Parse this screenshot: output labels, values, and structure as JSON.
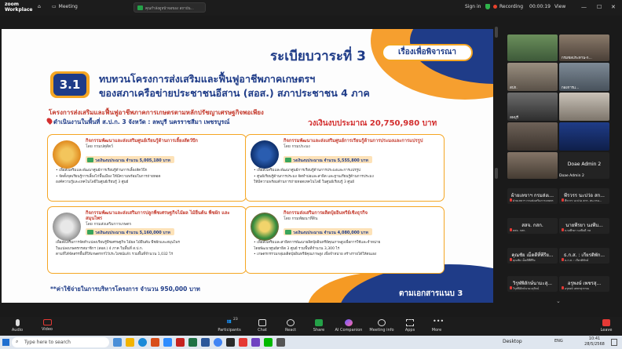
{
  "topbar": {
    "app_name_line1": "zoom",
    "app_name_line2": "Workplace",
    "meeting_label": "Meeting",
    "share_label": "คุณกำลังดูหน้าจอของ สถาบัน...",
    "sign_in": "Sign in",
    "recording_label": "Recording",
    "timer": "00:00:19",
    "view_label": "View"
  },
  "slide": {
    "agenda_title": "ระเบียบวาระที่ 3",
    "agenda_tag": "เรื่องเพื่อพิจารณา",
    "badge": "3.1",
    "heading_line1": "ทบทวนโครงการส่งเสริมและฟื้นฟูอาชีพภาคเกษตรฯ",
    "heading_line2": "ของสภาเครือข่ายประชาชนอีสาน (สอส.) สภาประชาชน 4 ภาค",
    "project_title": "โครงการส่งเสริมและฟื้นฟูอาชีพภาคการเกษตรตามหลักปรัชญาเศรษฐกิจพอเพียง",
    "project_area": "ดำเนินงานในพื้นที่ ส.ป.ก. 3 จังหวัด : ลพบุรี นครราชสีมา เพชรบูรณ์",
    "total_budget": "วงเงินงบประมาณ 20,750,980 บาท",
    "cards": [
      {
        "title": "กิจกรรมพัฒนาและส่งเสริมศูนย์เรียนรู้ด้านการเลี้ยงสัตว์ปีก",
        "org": "โดย กรมปศุสัตว์",
        "budget": "วงเงินงบประมาณ จำนวน 5,005,180 บาท",
        "bullets": [
          "• เพื่อส่งเสริมและพัฒนาศูนย์การเรียนรู้ด้านการเลี้ยงสัตว์ปีก",
          "• จัดตั้งจุดเรียนรู้การเลี้ยงไก่พื้นเมือง ให้มีความพร้อมในการถ่ายทอด",
          "  องค์ความรู้และเทคโนโลยีในศูนย์เรียนรู้ 3 ศูนย์"
        ]
      },
      {
        "title": "กิจกรรมพัฒนาและส่งเสริมศูนย์การเรียนรู้ด้านการประมงและการแปรรูป",
        "org": "โดย กรมประมง",
        "budget": "วงเงินงบประมาณ จำนวน 5,555,800 บาท",
        "bullets": [
          "• เพื่อส่งเสริมและพัฒนาศูนย์การเรียนรู้ด้านการประมงและการแปรรูป",
          "• ศูนย์เรียนรู้ด้านการประมง จัดทำบ่อและสาธิต และฐานเรียนรู้ด้านการประมง",
          "  ให้มีความพร้อมด้านการถ่ายทอดเทคโนโลยี ในศูนย์เรียนรู้ 3 ศูนย์"
        ]
      },
      {
        "title": "กิจกรรมพัฒนาและส่งเสริมการปลูกพืชเศรษฐกิจไม้ผล ไม้ยืนต้น พืชผัก และสมุนไพร",
        "org": "โดย กรมส่งเสริมการเกษตร",
        "budget": "วงเงินงบประมาณ จำนวน 5,160,000 บาท",
        "bullets": [
          "เพื่อส่งเสริมการจัดทำแปลงเรียนรู้พืชเศรษฐกิจ ไม้ผล ไม้ยืนต้น พืชผักและสมุนไพร",
          "ในแปลงเกษตรกรสมาชิกฯ (สอส.) 4 ภาค ในพื้นที่ ส.ป.ก.",
          "ตามที่ได้จัดสรรพื้นที่ให้เกษตรกรไว้ประโยชน์แล้ว รวมพื้นที่จำนวน 1,032 ไร่"
        ]
      },
      {
        "title": "กิจกรรมส่งเสริมการผลิตปุ๋ยอินทรีย์เชิงธุรกิจ",
        "org": "โดย กรมพัฒนาที่ดิน",
        "budget": "วงเงินงบประมาณ จำนวน 4,080,000 บาท",
        "bullets": [
          "• เพื่อส่งเสริมและสาธิตการพัฒนาผลิตปุ๋ยอินทรีย์คุณภาพสูงเพื่อการใช้และจำหน่าย",
          "  โดยพัฒนาศูนย์สาธิต 3 ศูนย์ รวมพื้นที่จำนวน 3,300 ไร่",
          "• เกษตรกรรวมกลุ่มผลิตปุ๋ยอินทรีย์คุณภาพสูง เพื่อจำหน่าย สร้างรายได้ให้ตนเอง"
        ]
      }
    ],
    "footer_note": "**ค่าใช้จ่ายในการบริหารโครงการ  จำนวน 950,000 บาท",
    "footer_ref": "ตามเอกสารแนบ 3"
  },
  "participants": {
    "video_tiles": [
      "",
      "",
      "",
      "",
      "",
      "",
      "",
      "",
      "",
      ""
    ],
    "video_labels": [
      "",
      "กรมชลประทาน-ก...",
      "สปก.",
      "กองการแ...",
      "ลพบุรี",
      "",
      "",
      "",
      "",
      ""
    ],
    "admin_label": "Doae Admin 2",
    "name_tiles": [
      {
        "name": "ผ้ายเลขาฯ กรมส่งเ...",
        "sub": "ฝ่ายเลขาฯ กรมส่งเสริมการเกษตร"
      },
      {
        "name": "พีรวรร นะบ่ว่อ สก...",
        "sub": "พีรวรร นะบ่ว่อ สกร. สบ.กรม..."
      },
      {
        "name": "สสจ. กสก.",
        "sub": "สสจ. กสก."
      },
      {
        "name": "นายพีรยา นงพีบ...",
        "sub": "นายพีรยา นงพีบดี กษ"
      },
      {
        "name": "คุณชัย เม็ดดีที่พีรีย...",
        "sub": "คุณชัย เม็ดดีที่พีรีย"
      },
      {
        "name": "ธ.ก.ส. : เกียรติพัก...",
        "sub": "ธ.ก.ส. : เกียรติพักษ์"
      },
      {
        "name": "วิรุฬพิลักษ์นามะสุ...",
        "sub": "วิรุฬพิลักษ์นามะสุรัตน์"
      },
      {
        "name": "อรุพงษ์ เพชรสุ...",
        "sub": "อรุพงษ์ เพชรสุวรรณ"
      }
    ]
  },
  "toolbar": {
    "audio": "Audio",
    "video": "Video",
    "participants": "Participants",
    "participants_count": "23",
    "chat": "Chat",
    "react": "React",
    "share": "Share",
    "ai_companion": "AI Companion",
    "meeting_info": "Meeting info",
    "apps": "Apps",
    "more": "More",
    "leave": "Leave"
  },
  "taskbar": {
    "search_placeholder": "Type here to search",
    "desktop_label": "Desktop",
    "time": "10:41",
    "date": "28/5/2568",
    "lang": "ENG"
  },
  "colors": {
    "accent_blue": "#1f3c88",
    "accent_orange": "#f5a623",
    "accent_red": "#c4392b",
    "zoom_green": "#24a148"
  }
}
